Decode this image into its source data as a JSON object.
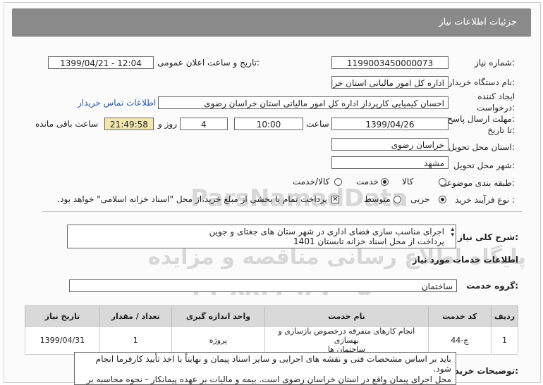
{
  "header": {
    "title": "جزئیات اطلاعات نیاز"
  },
  "fields": {
    "need_number": {
      "label": "شماره نیاز:",
      "value": "1199003450000073"
    },
    "announce_datetime": {
      "label": "تاریخ و ساعت اعلان عمومی:",
      "value": "1399/04/21 - 12:04"
    },
    "buyer_org": {
      "label": "نام دستگاه خریدار:",
      "value": "اداره کل امور مالیاتی استان خراسان رضوی"
    },
    "requester": {
      "label_line1": "ایجاد کننده",
      "label_line2": "درخواست:",
      "value": "احسان کیمیایی کارپرداز اداره کل امور مالیاتی استان خراسان رضوی"
    },
    "contact_link": "اطلاعات تماس خریدار",
    "deadline": {
      "label_line1": "مهلت ارسال پاسخ:",
      "label_line2": "تا تاریخ:",
      "date": "1399/04/26",
      "time_label": "ساعت",
      "time": "10:00",
      "days": "4",
      "days_label": "روز و",
      "remaining": "21:49:58",
      "remaining_label": "ساعت باقی مانده"
    },
    "province": {
      "label": "استان محل تحویل:",
      "value": "خراسان رضوی"
    },
    "city": {
      "label": "شهر محل تحویل:",
      "value": "مشهد"
    },
    "category": {
      "label": "طبقه بندی موضوعی:",
      "options": [
        "کالا",
        "خدمت",
        "کالا/خدمت"
      ],
      "selected": "خدمت"
    },
    "purchase_type": {
      "label": "نوع فرآیند خرید :",
      "options": [
        "جزیی",
        "متوسط"
      ],
      "selected": "جزیی",
      "payment_note": "پرداخت تمام یا بخشی از مبلغ خرید،از محل \"اسناد خزانه اسلامی\" خواهد بود."
    }
  },
  "description": {
    "label": "شرح کلی نیاز:",
    "line1": "اجرای مناسب سازی فضای اداری در شهر ستان های جغتای و جوین",
    "line2": "پرداخت از محل اسناد خزانه تابستان 1401"
  },
  "services_section": {
    "title": "اطلاعات خدمات مورد نیاز"
  },
  "service_group": {
    "label": "گروه خدمت:",
    "value": "ساختمان"
  },
  "table": {
    "headers": [
      "ردیف",
      "کد خدمت",
      "نام خدمت",
      "واحد اندازه گیری",
      "تعداد / مقدار",
      "تاریخ نیاز"
    ],
    "rows": [
      {
        "row": "1",
        "code": "ج-44",
        "name_line1": "انجام کارهای متفرقه درخصوص بازسازی و بهسازی",
        "name_line2": "ساختمان ها",
        "unit": "پروژه",
        "qty": "1",
        "date": "1399/04/31"
      }
    ]
  },
  "buyer_notes": {
    "label": "توضیحات خریدار:",
    "line1": "باید بر اساس مشخصات فنی و نقشه های اجرایی و سایر اسناد پیمان و نهایتاً با اخذ تأیید کارفرما انجام",
    "line2": "شود.",
    "line3": "محل اجرای پیمان واقع در استان خراسان رضوی است. بیمه و مالیات بر عهده پیمانکار - نحوه محاسبه بر"
  },
  "watermark": {
    "brand": "ParsNamadData",
    "line1": "پایگاه اطلاع رسانی مناقصه و مزایده",
    "phone": "۰۲۱-۸۸۳۴۹۶۷۰-۵"
  }
}
